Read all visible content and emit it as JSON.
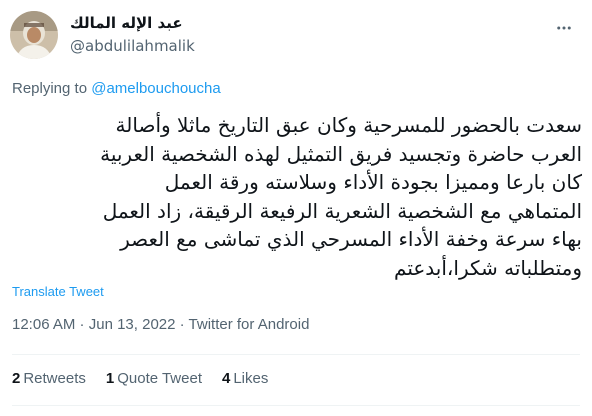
{
  "author": {
    "display_name": "عبد الإله المالك",
    "handle": "@abdulilahmalik"
  },
  "reply": {
    "prefix": "Replying to ",
    "to_handle": "@amelbouchoucha"
  },
  "tweet": {
    "lines": [
      "سعدت بالحضور للمسرحية وكان عبق التاريخ ماثلا وأصالة",
      "العرب حاضرة وتجسيد فريق التمثيل لهذه الشخصية العربية",
      "كان بارعا ومميزا بجودة الأداء وسلاسته ورقة العمل",
      "المتماهي مع الشخصية الشعرية الرفيعة الرقيقة، زاد العمل",
      "بهاء سرعة وخفة الأداء المسرحي الذي تماشى مع العصر",
      "ومتطلباته شكرا،أبدعتم"
    ],
    "translate_label": "Translate Tweet"
  },
  "meta": {
    "time": "12:06 AM",
    "separator": " · ",
    "date": "Jun 13, 2022",
    "source": "Twitter for Android"
  },
  "stats": {
    "retweets_count": "2",
    "retweets_label": "Retweets",
    "quotes_count": "1",
    "quotes_label": "Quote Tweet",
    "likes_count": "4",
    "likes_label": "Likes"
  },
  "icons": {
    "more": "more-horizontal-icon"
  },
  "colors": {
    "link": "#1d9bf0",
    "secondary_text": "#536471",
    "primary_text": "#0f1419",
    "divider": "#eff3f4"
  }
}
